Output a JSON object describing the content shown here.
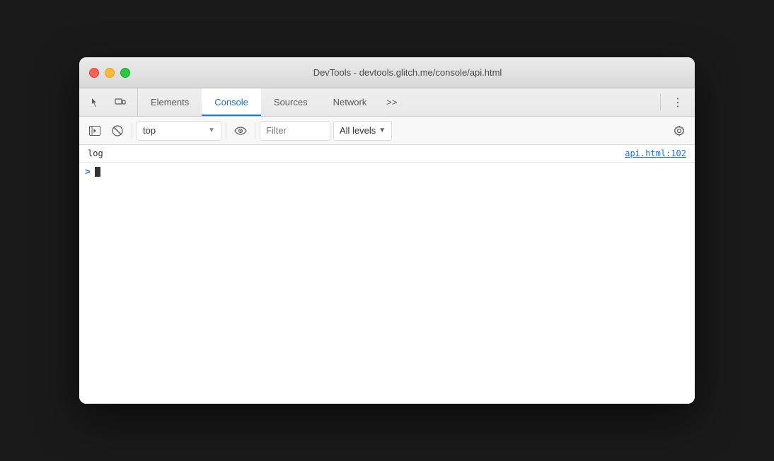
{
  "window": {
    "title": "DevTools - devtools.glitch.me/console/api.html"
  },
  "traffic_lights": {
    "close_label": "close",
    "minimize_label": "minimize",
    "maximize_label": "maximize"
  },
  "tabs": {
    "items": [
      {
        "id": "elements",
        "label": "Elements",
        "active": false
      },
      {
        "id": "console",
        "label": "Console",
        "active": true
      },
      {
        "id": "sources",
        "label": "Sources",
        "active": false
      },
      {
        "id": "network",
        "label": "Network",
        "active": false
      }
    ],
    "more_label": ">>",
    "more_options_label": "⋮"
  },
  "console_toolbar": {
    "sidebar_toggle_label": "▶",
    "clear_label": "🚫",
    "context_value": "top",
    "context_placeholder": "top",
    "filter_placeholder": "Filter",
    "filter_value": "",
    "levels_label": "All levels",
    "levels_arrow": "▼",
    "eye_label": "👁",
    "gear_label": "⚙"
  },
  "console_entries": [
    {
      "id": "entry-1",
      "text": "log",
      "source": "api.html:102"
    }
  ],
  "console_input": {
    "prompt": ">"
  }
}
